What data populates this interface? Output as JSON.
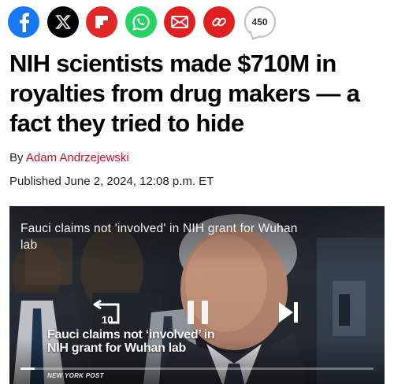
{
  "share": {
    "buttons": [
      {
        "name": "facebook",
        "icon": "facebook-icon",
        "color": "#1877f2"
      },
      {
        "name": "x",
        "icon": "x-logo-icon",
        "color": "#000000"
      },
      {
        "name": "flipboard",
        "icon": "flipboard-icon",
        "color": "#e12828"
      },
      {
        "name": "whatsapp",
        "icon": "whatsapp-icon",
        "color": "#25d366"
      },
      {
        "name": "email",
        "icon": "email-icon",
        "color": "#e02020"
      },
      {
        "name": "copy-link",
        "icon": "link-icon",
        "color": "#e02020"
      }
    ],
    "count": "450"
  },
  "article": {
    "headline": "NIH scientists made $710M in royalties from drug makers — a fact they tried to hide",
    "byline_prefix": "By ",
    "author": "Adam Andrzejewski",
    "published": "Published June 2, 2024, 12:08 p.m. ET"
  },
  "video": {
    "caption": "Fauci claims not 'involved' in NIH grant for Wuhan lab",
    "title_overlay": "Fauci claims not ‘involved’ in NIH grant for Wuhan lab",
    "rewind_seconds": "10",
    "brand": "NEW YORK POST",
    "progress": 0.04,
    "icons": {
      "rewind": "rewind-10-icon",
      "pause": "pause-icon",
      "next": "skip-next-icon"
    }
  },
  "colors": {
    "accent": "#c8102e"
  }
}
